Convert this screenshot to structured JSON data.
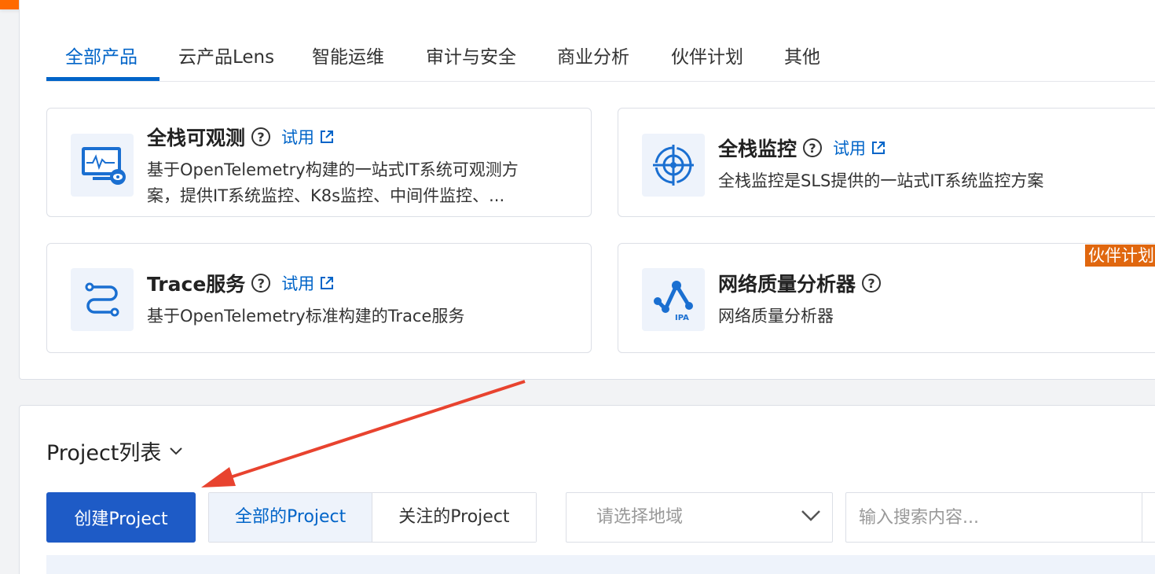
{
  "tabs": [
    {
      "label": "全部产品"
    },
    {
      "label": "云产品Lens"
    },
    {
      "label": "智能运维"
    },
    {
      "label": "审计与安全"
    },
    {
      "label": "商业分析"
    },
    {
      "label": "伙伴计划"
    },
    {
      "label": "其他"
    }
  ],
  "products": [
    {
      "title": "全栈可观测",
      "help": "?",
      "trial": "试用",
      "desc1": "基于OpenTelemetry构建的一站式IT系统可观测方",
      "desc2": "案，提供IT系统监控、K8s监控、中间件监控、...",
      "icon": "monitor-eye-icon"
    },
    {
      "title": "全栈监控",
      "help": "?",
      "trial": "试用",
      "desc1": "全栈监控是SLS提供的一站式IT系统监控方案",
      "icon": "target-icon"
    },
    {
      "title": "Trace服务",
      "help": "?",
      "trial": "试用",
      "desc1": "基于OpenTelemetry标准构建的Trace服务",
      "icon": "trace-path-icon"
    },
    {
      "title": "网络质量分析器",
      "help": "?",
      "desc1": "网络质量分析器",
      "icon": "ipa-network-icon",
      "icon_text": "IPA"
    }
  ],
  "partner_tag": "伙伴计划",
  "project": {
    "title": "Project列表",
    "create_button": "创建Project",
    "segments": [
      "全部的Project",
      "关注的Project"
    ],
    "region_placeholder": "请选择地域",
    "search_placeholder": "输入搜索内容..."
  },
  "colors": {
    "primary": "#0064c8",
    "button": "#1e5bc6",
    "orange": "#ff6a00",
    "annotation_arrow": "#e8432f"
  }
}
